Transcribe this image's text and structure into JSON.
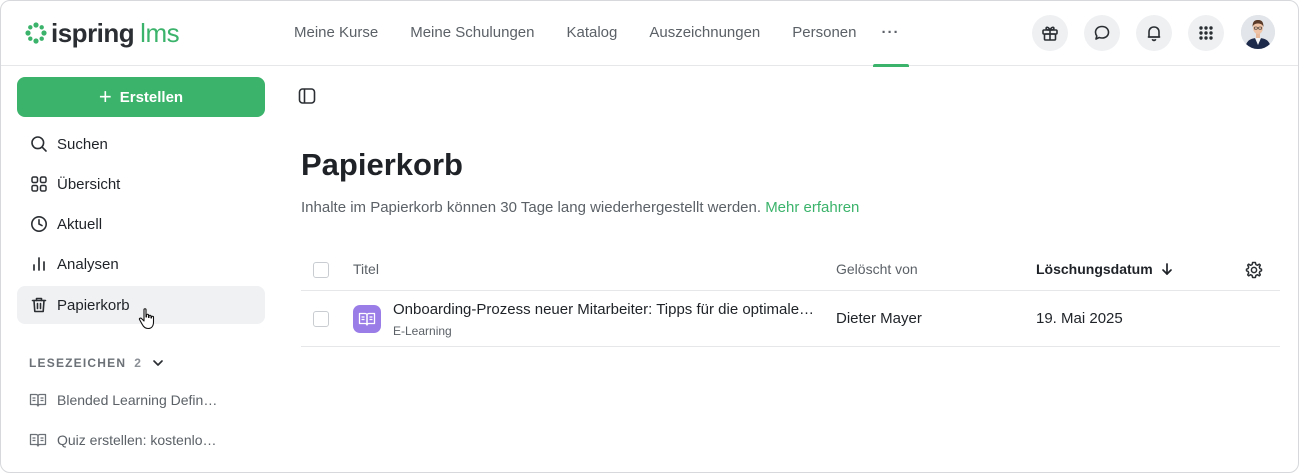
{
  "brand": {
    "name": "ispring",
    "product": "lms",
    "accent": "#3bb36b"
  },
  "nav": {
    "items": [
      "Meine Kurse",
      "Meine Schulungen",
      "Katalog",
      "Auszeichnungen",
      "Personen"
    ],
    "more": "···"
  },
  "header_icons": [
    "gift-icon",
    "chat-icon",
    "bell-icon",
    "apps-grid-icon"
  ],
  "sidebar": {
    "create_label": "Erstellen",
    "items": [
      {
        "label": "Suchen",
        "icon": "search-icon"
      },
      {
        "label": "Übersicht",
        "icon": "grid-icon"
      },
      {
        "label": "Aktuell",
        "icon": "clock-icon"
      },
      {
        "label": "Analysen",
        "icon": "bar-chart-icon"
      },
      {
        "label": "Papierkorb",
        "icon": "trash-icon",
        "active": true
      }
    ],
    "bookmarks": {
      "title": "LESEZEICHEN",
      "count": "2",
      "items": [
        "Blended Learning Defin…",
        "Quiz erstellen: kostenlo…"
      ]
    }
  },
  "main": {
    "title": "Papierkorb",
    "description": "Inhalte im Papierkorb können 30 Tage lang wiederhergestellt werden.",
    "learn_more": "Mehr erfahren",
    "table": {
      "columns": {
        "title": "Titel",
        "deleted_by": "Gelöscht von",
        "deletion_date": "Löschungsdatum"
      },
      "rows": [
        {
          "title": "Onboarding-Prozess neuer Mitarbeiter: Tipps für die optimale …",
          "type": "E-Learning",
          "deleted_by": "Dieter Mayer",
          "deletion_date": "19. Mai 2025"
        }
      ]
    }
  }
}
